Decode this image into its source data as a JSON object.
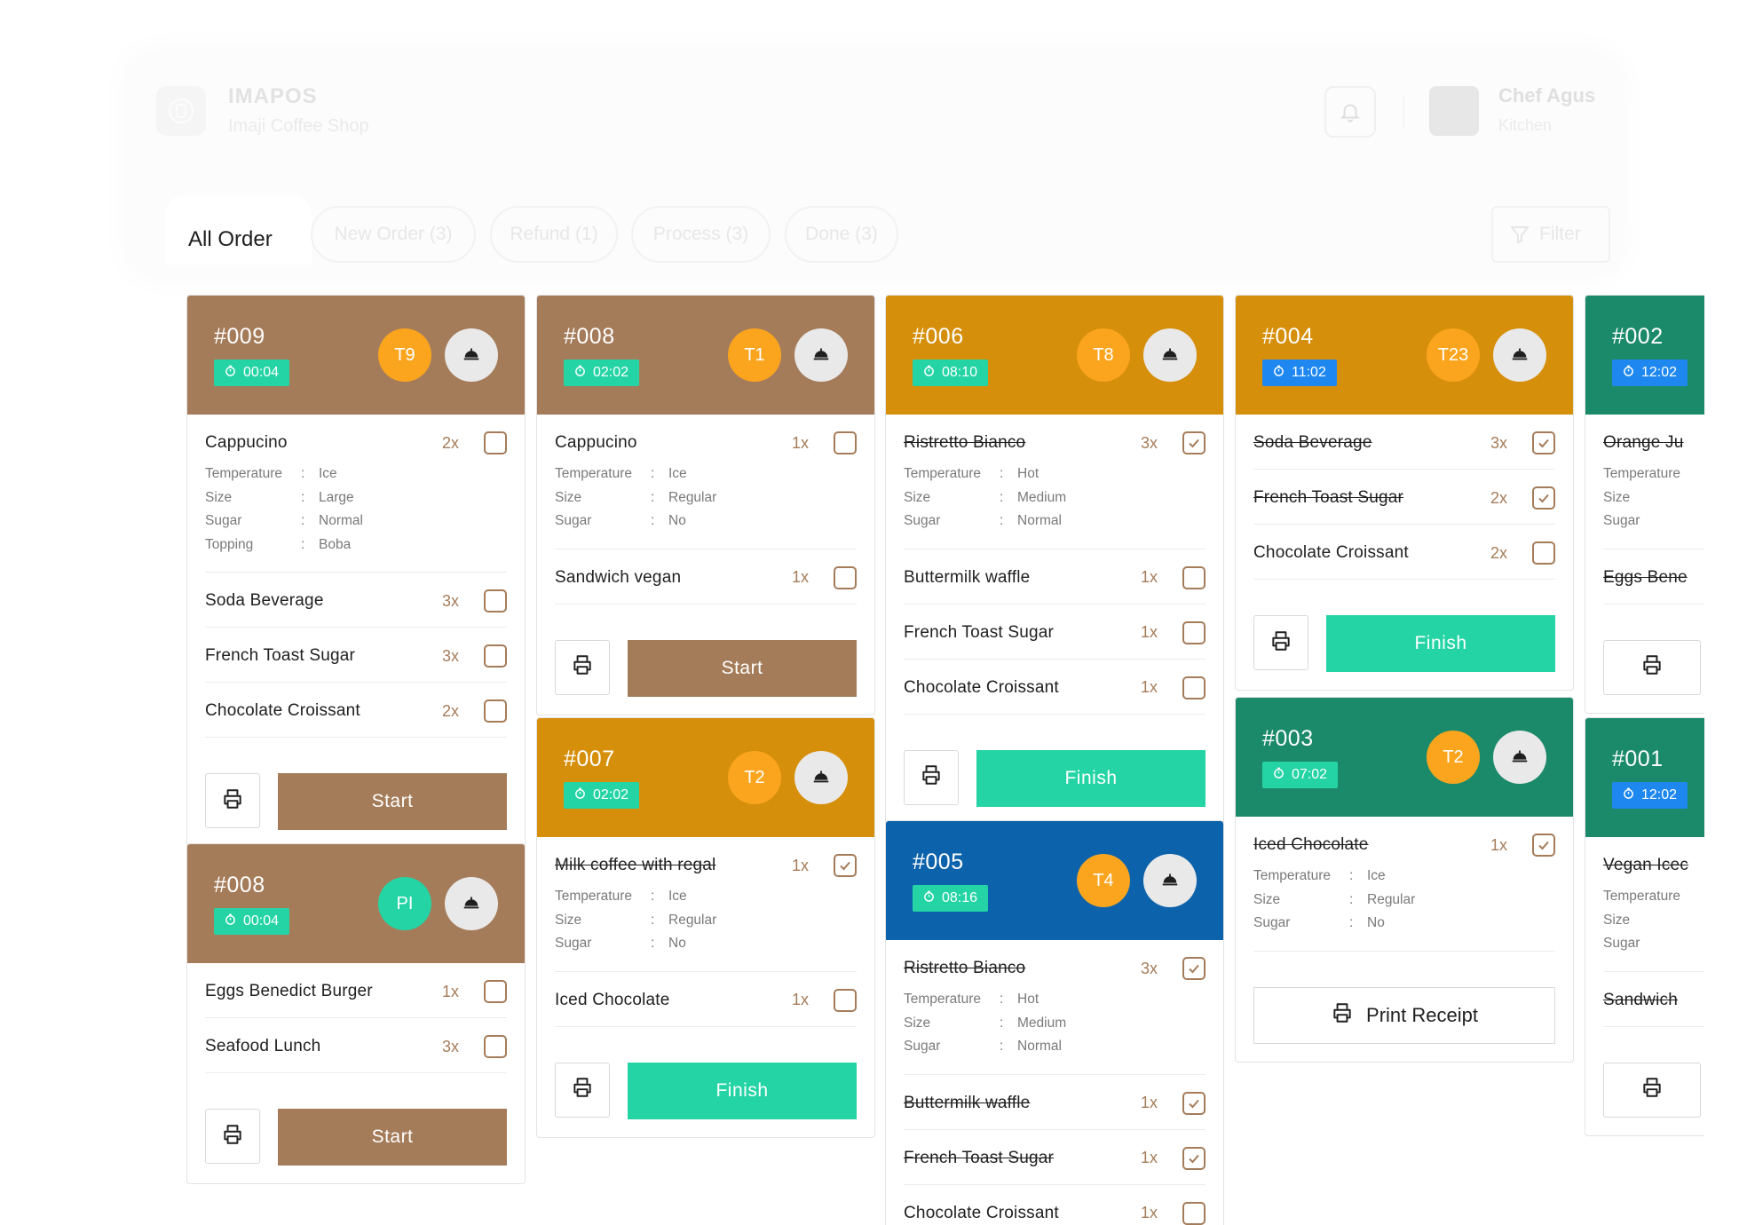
{
  "header": {
    "app_name": "IMAPOS",
    "shop_name": "Imaji Coffee Shop",
    "user_name": "Chef Agus",
    "user_role": "Kitchen"
  },
  "tabs": {
    "active": "All Order",
    "new_order": "New Order (3)",
    "refund": "Refund (1)",
    "process": "Process (3)",
    "done": "Done (3)",
    "filter": "Filter"
  },
  "colors": {
    "brown": "#a57c5a",
    "orange": "#d68f0a",
    "green": "#1b8a6a",
    "blue": "#0d63ab",
    "teal": "#24d4a5",
    "timer_blue": "#1e88f0",
    "amber_badge": "#fba51f"
  },
  "cards": [
    {
      "id": "#009",
      "timer": "00:04",
      "table": "T9",
      "status": "brown",
      "items": [
        {
          "name": "Cappucino",
          "qty": "2x",
          "done": false,
          "mods": [
            [
              "Temperature",
              "Ice"
            ],
            [
              "Size",
              "Large"
            ],
            [
              "Sugar",
              "Normal"
            ],
            [
              "Topping",
              "Boba"
            ]
          ]
        },
        {
          "name": "Soda Beverage",
          "qty": "3x",
          "done": false
        },
        {
          "name": "French Toast Sugar",
          "qty": "3x",
          "done": false
        },
        {
          "name": "Chocolate Croissant",
          "qty": "2x",
          "done": false
        }
      ],
      "action": "Start"
    },
    {
      "id": "#008",
      "timer": "00:04",
      "table": "PI",
      "status": "brown",
      "items": [
        {
          "name": "Eggs Benedict Burger",
          "qty": "1x",
          "done": false
        },
        {
          "name": "Seafood Lunch",
          "qty": "3x",
          "done": false
        }
      ],
      "action": "Start"
    },
    {
      "id": "#008",
      "timer": "02:02",
      "table": "T1",
      "status": "brown",
      "items": [
        {
          "name": "Cappucino",
          "qty": "1x",
          "done": false,
          "mods": [
            [
              "Temperature",
              "Ice"
            ],
            [
              "Size",
              "Regular"
            ],
            [
              "Sugar",
              "No"
            ]
          ]
        },
        {
          "name": "Sandwich vegan",
          "qty": "1x",
          "done": false
        }
      ],
      "action": "Start"
    },
    {
      "id": "#007",
      "timer": "02:02",
      "table": "T2",
      "status": "orange",
      "items": [
        {
          "name": "Milk coffee with regal",
          "qty": "1x",
          "done": true,
          "mods": [
            [
              "Temperature",
              "Ice"
            ],
            [
              "Size",
              "Regular"
            ],
            [
              "Sugar",
              "No"
            ]
          ]
        },
        {
          "name": "Iced Chocolate",
          "qty": "1x",
          "done": false
        }
      ],
      "action": "Finish"
    },
    {
      "id": "#006",
      "timer": "08:10",
      "table": "T8",
      "status": "orange",
      "items": [
        {
          "name": "Ristretto Bianco",
          "qty": "3x",
          "done": true,
          "mods": [
            [
              "Temperature",
              "Hot"
            ],
            [
              "Size",
              "Medium"
            ],
            [
              "Sugar",
              "Normal"
            ]
          ]
        },
        {
          "name": "Buttermilk waffle",
          "qty": "1x",
          "done": false
        },
        {
          "name": "French Toast Sugar",
          "qty": "1x",
          "done": false
        },
        {
          "name": "Chocolate Croissant",
          "qty": "1x",
          "done": false
        }
      ],
      "action": "Finish"
    },
    {
      "id": "#005",
      "timer": "08:16",
      "table": "T4",
      "status": "blue",
      "items": [
        {
          "name": "Ristretto Bianco",
          "qty": "3x",
          "done": true,
          "mods": [
            [
              "Temperature",
              "Hot"
            ],
            [
              "Size",
              "Medium"
            ],
            [
              "Sugar",
              "Normal"
            ]
          ]
        },
        {
          "name": "Buttermilk waffle",
          "qty": "1x",
          "done": true
        },
        {
          "name": "French Toast Sugar",
          "qty": "1x",
          "done": true
        },
        {
          "name": "Chocolate Croissant",
          "qty": "1x",
          "done": false
        }
      ],
      "action": ""
    },
    {
      "id": "#004",
      "timer": "11:02",
      "table": "T23",
      "status": "orange",
      "timer_color": "blue",
      "items": [
        {
          "name": "Soda Beverage",
          "qty": "3x",
          "done": true
        },
        {
          "name": "French Toast Sugar",
          "qty": "2x",
          "done": true
        },
        {
          "name": "Chocolate Croissant",
          "qty": "2x",
          "done": false
        }
      ],
      "action": "Finish"
    },
    {
      "id": "#003",
      "timer": "07:02",
      "table": "T2",
      "status": "green",
      "items": [
        {
          "name": "Iced Chocolate",
          "qty": "1x",
          "done": true,
          "mods": [
            [
              "Temperature",
              "Ice"
            ],
            [
              "Size",
              "Regular"
            ],
            [
              "Sugar",
              "No"
            ]
          ]
        }
      ],
      "action": "Print Receipt"
    },
    {
      "id": "#002",
      "timer": "12:02",
      "table": "",
      "status": "green",
      "timer_color": "blue",
      "items": [
        {
          "name": "Orange Ju",
          "qty": "",
          "done": true,
          "mods": [
            [
              "Temperature",
              ""
            ],
            [
              "Size",
              ""
            ],
            [
              "Sugar",
              ""
            ]
          ]
        },
        {
          "name": "Eggs Bene",
          "qty": "",
          "done": true
        }
      ],
      "action": ""
    },
    {
      "id": "#001",
      "timer": "12:02",
      "table": "",
      "status": "green",
      "timer_color": "blue",
      "items": [
        {
          "name": "Vegan Icec",
          "qty": "",
          "done": true,
          "mods": [
            [
              "Temperature",
              ""
            ],
            [
              "Size",
              ""
            ],
            [
              "Sugar",
              ""
            ]
          ]
        },
        {
          "name": "Sandwich",
          "qty": "",
          "done": true
        }
      ],
      "action": ""
    }
  ]
}
